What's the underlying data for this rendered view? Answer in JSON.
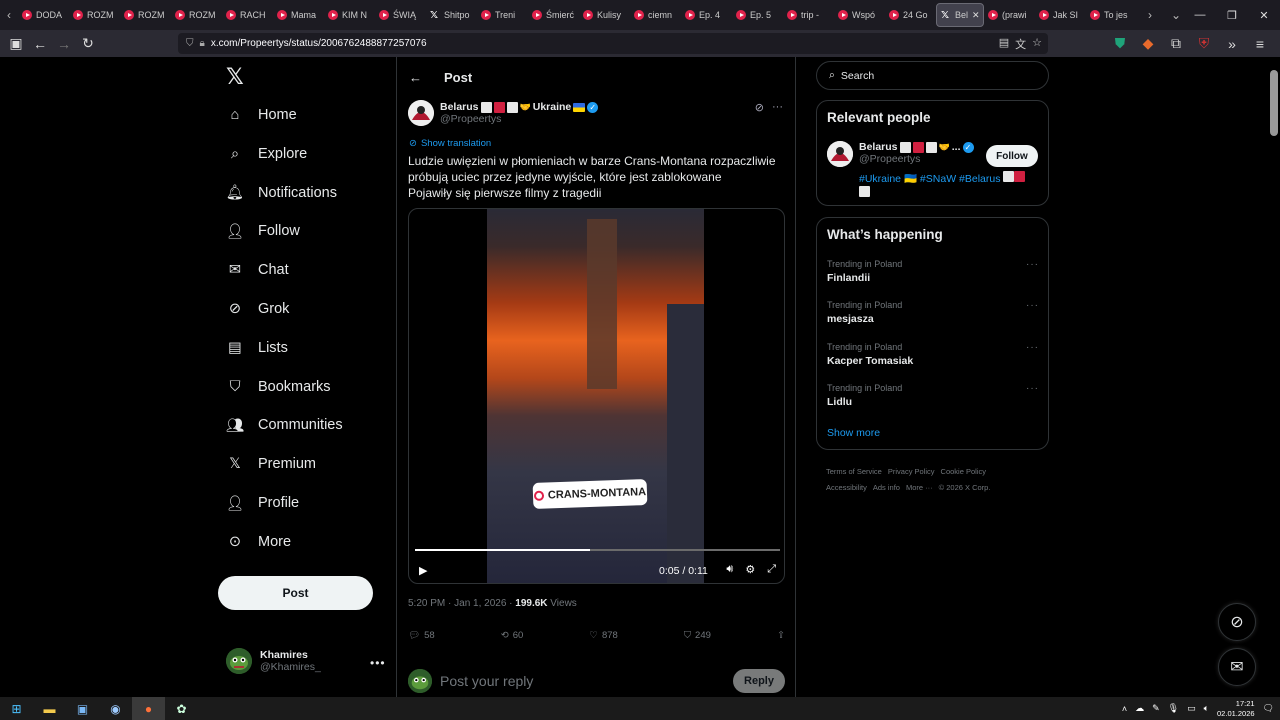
{
  "browser": {
    "tabs": [
      {
        "label": "DODA"
      },
      {
        "label": "ROZM"
      },
      {
        "label": "ROZM"
      },
      {
        "label": "ROZM"
      },
      {
        "label": "RACH"
      },
      {
        "label": "Mama"
      },
      {
        "label": "KIM N"
      },
      {
        "label": "ŚWIĄ"
      },
      {
        "label": "Shitpo"
      },
      {
        "label": "Treni"
      },
      {
        "label": "Śmierć"
      },
      {
        "label": "Kulisy"
      },
      {
        "label": "ciemn"
      },
      {
        "label": "Ep. 4"
      },
      {
        "label": "Ep. 5"
      },
      {
        "label": "trip -"
      },
      {
        "label": "Wspó"
      },
      {
        "label": "24 Go"
      },
      {
        "label": "Bel"
      },
      {
        "label": "(prawi"
      },
      {
        "label": "Jak SI"
      },
      {
        "label": "To jes"
      }
    ],
    "active_tab_index": 18,
    "url": "x.com/Propeertys/status/2006762488877257076"
  },
  "nav": {
    "items": [
      {
        "label": "Home",
        "icon": "home-icon"
      },
      {
        "label": "Explore",
        "icon": "search-icon"
      },
      {
        "label": "Notifications",
        "icon": "bell-icon"
      },
      {
        "label": "Follow",
        "icon": "person-plus-icon"
      },
      {
        "label": "Chat",
        "icon": "envelope-icon"
      },
      {
        "label": "Grok",
        "icon": "grok-icon"
      },
      {
        "label": "Lists",
        "icon": "list-icon"
      },
      {
        "label": "Bookmarks",
        "icon": "bookmark-icon"
      },
      {
        "label": "Communities",
        "icon": "people-icon"
      },
      {
        "label": "Premium",
        "icon": "x-icon"
      },
      {
        "label": "Profile",
        "icon": "person-icon"
      },
      {
        "label": "More",
        "icon": "more-circle-icon"
      }
    ],
    "post_button": "Post",
    "account": {
      "name": "Khamires",
      "handle": "@Khamires_"
    }
  },
  "post": {
    "header_title": "Post",
    "author_name": "Belarus",
    "author_name_tail": "Ukraine",
    "author_handle": "@Propeertys",
    "show_translation": "Show translation",
    "text_line1": "Ludzie uwięzieni w płomieniach w barze Crans-Montana rozpaczliwie",
    "text_line2": "próbują uciec przez jedyne wyjście, które jest zablokowane",
    "text_line3": "Pojawiły się pierwsze filmy z tragedii",
    "video": {
      "location_label": "CRANS-MONTANA",
      "time": "0:05 / 0:11",
      "progress": 0.48
    },
    "timestamp": "5:20 PM · Jan 1, 2026 · ",
    "views_count": "199.6K",
    "views_label": " Views",
    "replies": "58",
    "reposts": "60",
    "likes": "878",
    "bookmarks": "249",
    "reply_placeholder": "Post your reply",
    "reply_button": "Reply"
  },
  "sidebar": {
    "search_placeholder": "Search",
    "relevant_title": "Relevant people",
    "relevant_name": "Belarus",
    "relevant_name_tail": "...",
    "relevant_handle": "@Propeertys",
    "relevant_bio": "#Ukraine 🇺🇦 #SNaW #Belarus",
    "follow_button": "Follow",
    "happening_title": "What’s happening",
    "trends": [
      {
        "category": "Trending in Poland",
        "name": "Finlandii"
      },
      {
        "category": "Trending in Poland",
        "name": "mesjasza"
      },
      {
        "category": "Trending in Poland",
        "name": "Kacper Tomasiak"
      },
      {
        "category": "Trending in Poland",
        "name": "Lidlu"
      }
    ],
    "show_more": "Show more",
    "footer": [
      "Terms of Service",
      "Privacy Policy",
      "Cookie Policy",
      "Accessibility",
      "Ads info",
      "More ···",
      "© 2026 X Corp."
    ]
  },
  "taskbar": {
    "time": "17:21",
    "date": "02.01.2026"
  },
  "colors": {
    "accent": "#1d9bf0",
    "background": "#000000",
    "text": "#e7e9ea",
    "muted": "#71767b"
  }
}
